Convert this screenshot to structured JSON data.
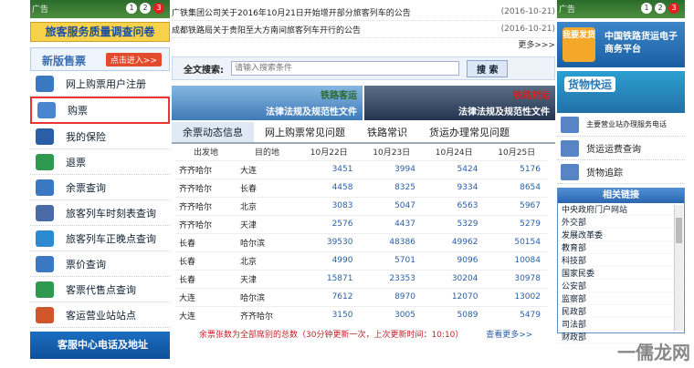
{
  "left": {
    "ad_label": "广告",
    "ad_pages": [
      "1",
      "2",
      "3"
    ],
    "survey": "旅客服务质量调查问卷",
    "newversion_title": "新版售票",
    "newversion_btn": "点击进入>>",
    "menu": [
      {
        "label": "网上购票用户注册",
        "icon": "user-icon",
        "color": "#3b78c2"
      },
      {
        "label": "购票",
        "icon": "ticket-icon",
        "color": "#4a86d0"
      },
      {
        "label": "我的保险",
        "icon": "shield-icon",
        "color": "#2b5ea6"
      },
      {
        "label": "退票",
        "icon": "return-icon",
        "color": "#2f9a4f"
      },
      {
        "label": "余票查询",
        "icon": "ticket-search-icon",
        "color": "#3b78c2"
      },
      {
        "label": "旅客列车时刻表查询",
        "icon": "train-icon",
        "color": "#4a6aa8"
      },
      {
        "label": "旅客列车正晚点查询",
        "icon": "clock-icon",
        "color": "#2b8ad0"
      },
      {
        "label": "票价查询",
        "icon": "price-icon",
        "color": "#3b78c2"
      },
      {
        "label": "客票代售点查询",
        "icon": "shop-icon",
        "color": "#2f9a4f"
      },
      {
        "label": "客运营业站站点",
        "icon": "house-icon",
        "color": "#d0552a"
      }
    ],
    "service": "客服中心电话及地址"
  },
  "center": {
    "news": [
      {
        "title": "广铁集团公司关于2016年10月21日开始增开部分旅客列车的公告",
        "date": "(2016-10-21)"
      },
      {
        "title": "成都铁路局关于贵阳至大方南间旅客列车开行的公告",
        "date": "(2016-10-21)"
      }
    ],
    "more": "更多>>>",
    "search_label": "全文搜索:",
    "search_placeholder": "请输入搜索条件",
    "search_btn": "搜 索",
    "banner1_tag": "铁路客运",
    "banner1_text": "法律法规及规范性文件",
    "banner2_tag": "铁路货运",
    "banner2_text": "法律法规及规范性文件",
    "tabs": [
      "余票动态信息",
      "网上购票常见问题",
      "铁路常识",
      "货运办理常见问题"
    ],
    "table_headers": [
      "出发地",
      "目的地",
      "10月22日",
      "10月23日",
      "10月24日",
      "10月25日"
    ],
    "rows": [
      [
        "齐齐哈尔",
        "大连",
        "3451",
        "3994",
        "5424",
        "5176"
      ],
      [
        "齐齐哈尔",
        "长春",
        "4458",
        "8325",
        "9334",
        "8654"
      ],
      [
        "齐齐哈尔",
        "北京",
        "3083",
        "5047",
        "6563",
        "5967"
      ],
      [
        "齐齐哈尔",
        "天津",
        "2576",
        "4437",
        "5329",
        "5279"
      ],
      [
        "长春",
        "哈尔滨",
        "39530",
        "48386",
        "49962",
        "50154"
      ],
      [
        "长春",
        "北京",
        "4990",
        "5701",
        "9096",
        "10084"
      ],
      [
        "长春",
        "天津",
        "15871",
        "23353",
        "30204",
        "30978"
      ],
      [
        "大连",
        "哈尔滨",
        "7612",
        "8970",
        "12070",
        "13002"
      ],
      [
        "大连",
        "齐齐哈尔",
        "3150",
        "3005",
        "5089",
        "5479"
      ]
    ],
    "note": "余票张数为全部席别的总数（30分钟更新一次，上次更新时间：10:10）",
    "note_link": "查看更多>>"
  },
  "right": {
    "ad_label": "广告",
    "ad_pages": [
      "1",
      "2",
      "3"
    ],
    "ebiz_btn": "我要发货",
    "ebiz_text": "中国铁路货运电子商务平台",
    "freight": "货物快运",
    "menu": [
      {
        "label": "主要营业站办理服务电话",
        "small": true
      },
      {
        "label": "货运运费查询",
        "small": false
      },
      {
        "label": "货物追踪",
        "small": false
      }
    ],
    "links_title": "相关链接",
    "links": [
      "中央政府门户网站",
      "外交部",
      "发展改革委",
      "教育部",
      "科技部",
      "国家民委",
      "公安部",
      "监察部",
      "民政部",
      "司法部",
      "财政部"
    ]
  },
  "watermark": "一儒龙网"
}
